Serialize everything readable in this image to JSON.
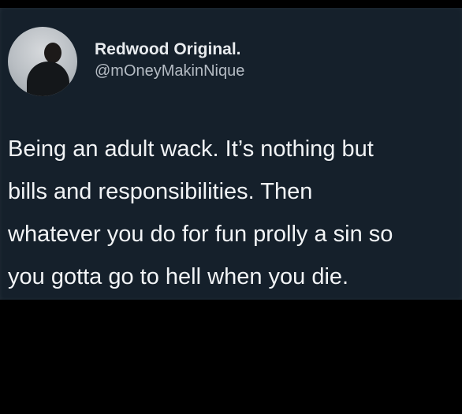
{
  "tweet": {
    "display_name": "Redwood Original.",
    "handle": "@mOneyMakinNique",
    "text_lines": [
      "Being an adult wack. It’s nothing but",
      "bills and responsibilities. Then",
      "whatever you do for fun prolly a sin so",
      "you gotta go to hell when you die."
    ]
  },
  "colors": {
    "tweet_background": "#15202b",
    "page_background": "#000000",
    "primary_text": "#f2f4f6",
    "secondary_text": "#b5bcc4"
  }
}
